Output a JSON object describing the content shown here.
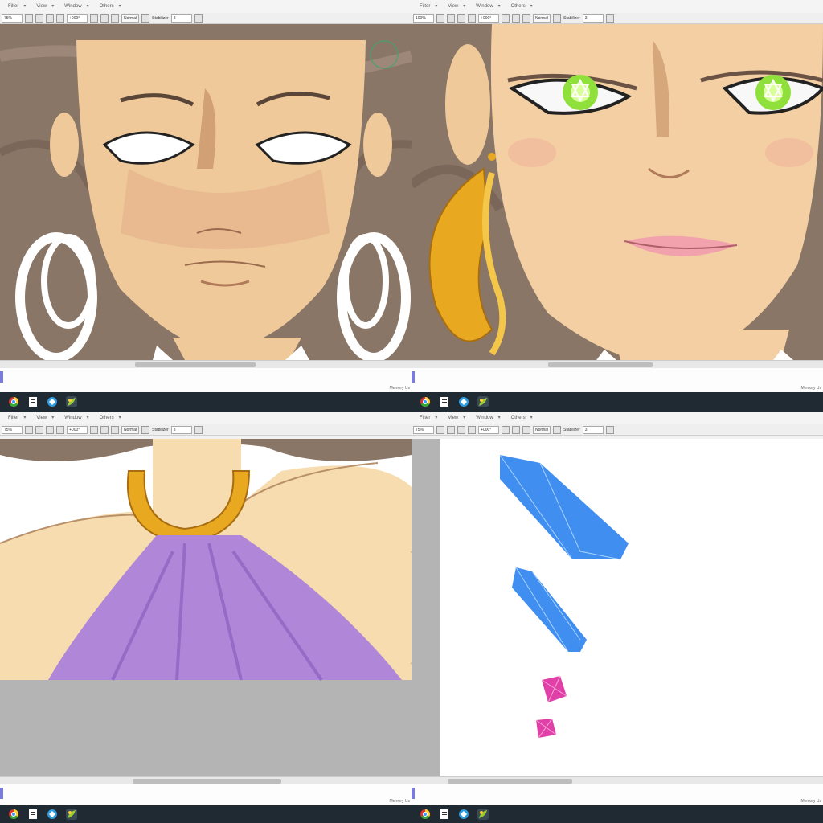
{
  "panels": [
    {
      "menus": [
        "Filter",
        "View",
        "Window",
        "Others"
      ],
      "toolbar": {
        "zoom": "75%",
        "angle": "+000°",
        "mode": "Normal",
        "stabilizer_label": "Stabilizer",
        "stabilizer": "3"
      },
      "status": {
        "memory": "Memory Us"
      },
      "taskbar": [
        "chrome-icon",
        "notes-icon",
        "app-icon",
        "paint-icon"
      ]
    },
    {
      "menus": [
        "Filter",
        "View",
        "Window",
        "Others"
      ],
      "toolbar": {
        "zoom": "100%",
        "angle": "+000°",
        "mode": "Normal",
        "stabilizer_label": "Stabilizer",
        "stabilizer": "3"
      },
      "status": {
        "memory": "Memory Us"
      },
      "taskbar": [
        "chrome-icon",
        "notes-icon",
        "app-icon",
        "paint-icon"
      ]
    },
    {
      "menus": [
        "Filter",
        "View",
        "Window",
        "Others"
      ],
      "toolbar": {
        "zoom": "75%",
        "angle": "+000°",
        "mode": "Normal",
        "stabilizer_label": "Stabilizer",
        "stabilizer": "3"
      },
      "status": {
        "memory": "Memory Us"
      },
      "taskbar": [
        "chrome-icon",
        "notes-icon",
        "app-icon",
        "paint-icon"
      ]
    },
    {
      "menus": [
        "Filter",
        "View",
        "Window",
        "Others"
      ],
      "toolbar": {
        "zoom": "75%",
        "angle": "+000°",
        "mode": "Normal",
        "stabilizer_label": "Stabilizer",
        "stabilizer": "3"
      },
      "status": {
        "memory": "Memory Us"
      },
      "taskbar": [
        "chrome-icon",
        "notes-icon",
        "app-icon",
        "paint-icon"
      ]
    }
  ],
  "colors": {
    "hair": "#8a7667",
    "skin": "#f0c99a",
    "skin_shadow": "#c9966a",
    "eye_green": "#8fe03a",
    "gold": "#e8a920",
    "purple": "#b087d8",
    "crystal_blue": "#3f8ef0",
    "crystal_pink": "#e040a8",
    "taskbar": "#1f2a33",
    "statusbar_indicator": "#7b7bd8"
  }
}
